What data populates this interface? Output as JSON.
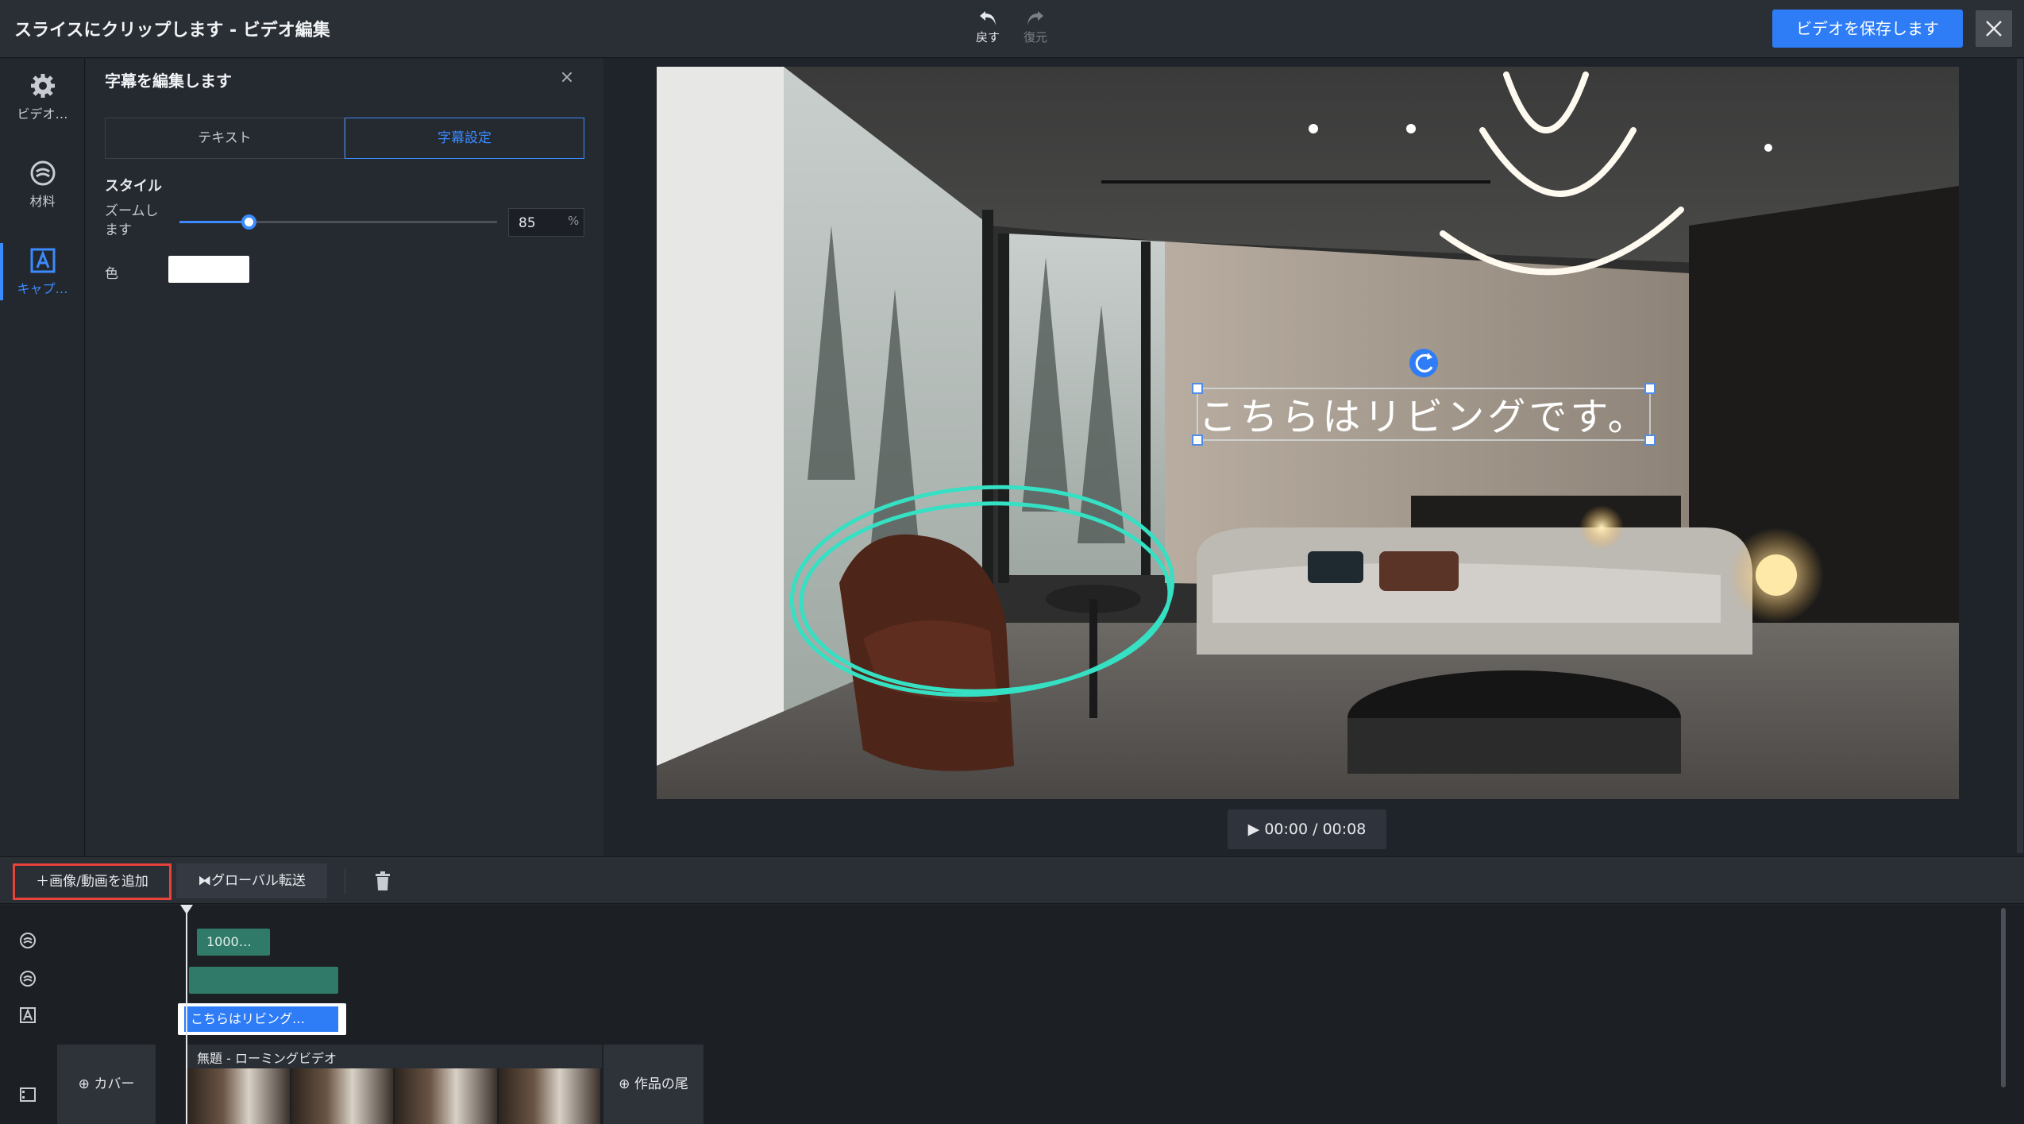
{
  "app": {
    "title": "スライスにクリップします - ビデオ編集"
  },
  "history": {
    "undo_label": "戻す",
    "redo_label": "復元"
  },
  "header": {
    "save_label": "ビデオを保存します"
  },
  "sidebar": {
    "items": [
      {
        "label": "ビデオ…",
        "icon": "gear-icon"
      },
      {
        "label": "材料",
        "icon": "material-icon"
      },
      {
        "label": "キャプ…",
        "icon": "caption-icon",
        "active": true
      }
    ]
  },
  "panel": {
    "title": "字幕を編集します",
    "tabs": [
      {
        "label": "テキスト"
      },
      {
        "label": "字幕設定",
        "active": true
      }
    ],
    "style_label": "スタイル",
    "zoom_label": "ズームします",
    "zoom_value": "85",
    "zoom_unit": "%",
    "zoom_level": 0.22,
    "color_label": "色",
    "color_value": "#ffffff"
  },
  "preview": {
    "caption_text": "こちらはリビングです。",
    "time": "00:00 / 00:08",
    "annotation_color": "#35e0c3"
  },
  "toolbar": {
    "add_media_label": "画像/動画を追加",
    "global_transition_label": "グローバル転送"
  },
  "timeline": {
    "audio_clip_1_label": "1000…",
    "caption_clip_label": "こちらはリビング…",
    "video_clip_title": "無題 - ローミングビデオ",
    "cover_label": "カバー",
    "tail_label": "作品の尾"
  },
  "colors": {
    "accent": "#2e7df6",
    "highlight": "#e8423a",
    "clip_green": "#2f7a68"
  }
}
